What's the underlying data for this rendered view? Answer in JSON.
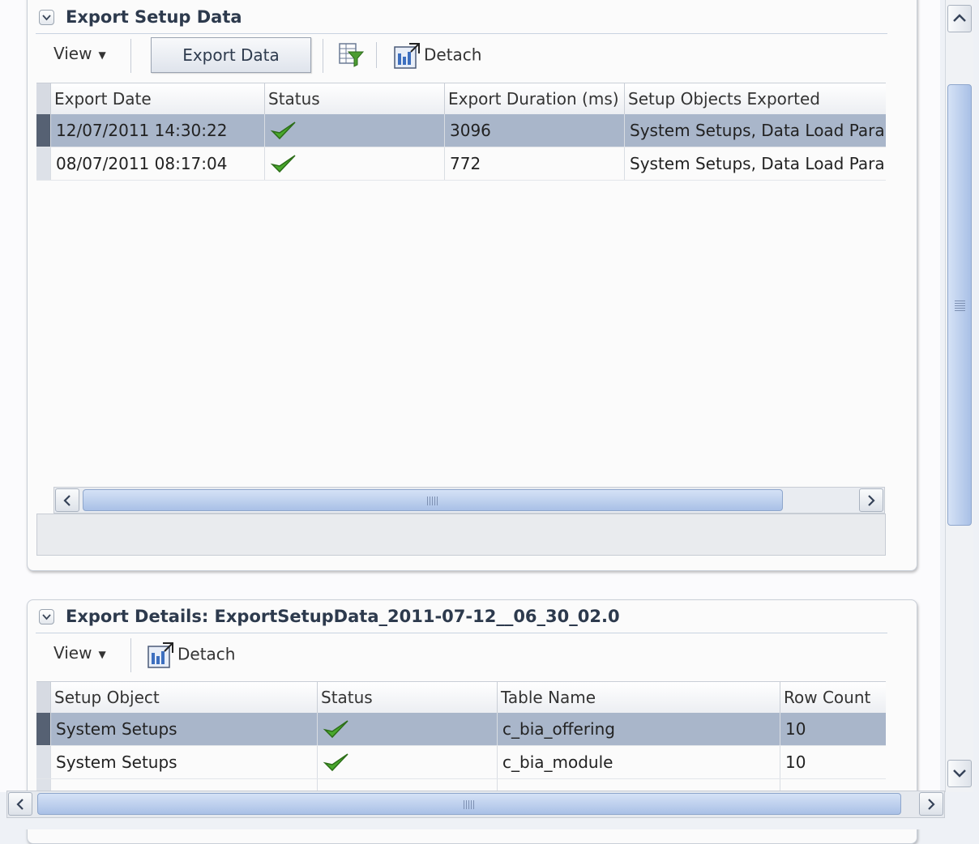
{
  "export_setup_panel": {
    "title": "Export Setup Data",
    "toolbar": {
      "view_label": "View",
      "export_button": "Export Data",
      "detach_label": "Detach"
    },
    "columns": [
      "Export Date",
      "Status",
      "Export Duration (ms)",
      "Setup Objects Exported"
    ],
    "rows": [
      {
        "date": "12/07/2011 14:30:22",
        "status": "success",
        "duration": "3096",
        "objects": "System Setups, Data Load Parameters",
        "selected": true
      },
      {
        "date": "08/07/2011 08:17:04",
        "status": "success",
        "duration": "772",
        "objects": "System Setups, Data Load Parameters",
        "selected": false
      }
    ]
  },
  "export_details_panel": {
    "title": "Export Details: ExportSetupData_2011-07-12__06_30_02.0",
    "toolbar": {
      "view_label": "View",
      "detach_label": "Detach"
    },
    "columns": [
      "Setup Object",
      "Status",
      "Table Name",
      "Row Count"
    ],
    "rows": [
      {
        "object": "System Setups",
        "status": "success",
        "table": "c_bia_offering",
        "count": "10",
        "selected": true
      },
      {
        "object": "System Setups",
        "status": "success",
        "table": "c_bia_module",
        "count": "10",
        "selected": false
      }
    ]
  },
  "icons": {
    "disclosure": "chevron-down-icon",
    "query_by_example": "filter-table-icon",
    "detach": "detach-icon",
    "status_success": "green-check-icon"
  },
  "colors": {
    "selected_row": "#a9b6ca",
    "accent": "#a9c0e6",
    "success": "#3f9b26"
  }
}
